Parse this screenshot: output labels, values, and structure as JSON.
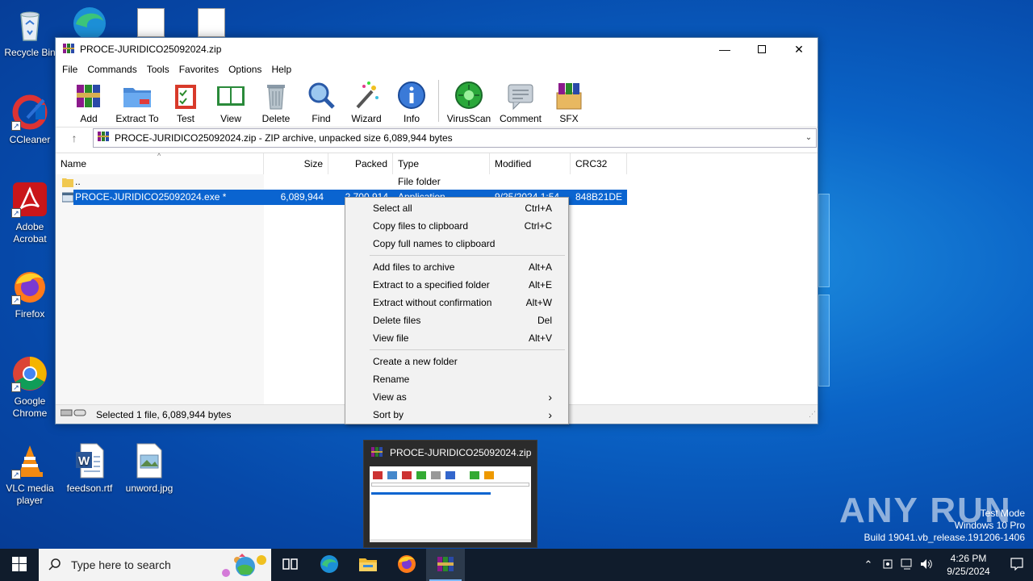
{
  "desktop": {
    "icons": [
      {
        "label": "Recycle Bin",
        "icon": "recycle-bin-icon"
      },
      {
        "label": "CCleaner",
        "icon": "ccleaner-icon"
      },
      {
        "label": "Adobe Acrobat",
        "icon": "adobe-acrobat-icon"
      },
      {
        "label": "Firefox",
        "icon": "firefox-icon"
      },
      {
        "label": "Google Chrome",
        "icon": "chrome-icon"
      },
      {
        "label": "VLC media player",
        "icon": "vlc-icon"
      },
      {
        "label": "feedson.rtf",
        "icon": "word-document-icon"
      },
      {
        "label": "unword.jpg",
        "icon": "image-file-icon"
      }
    ],
    "watermark": {
      "line1": "Test Mode",
      "line2": "Windows 10 Pro",
      "line3": "Build 19041.vb_release.191206-1406"
    },
    "brand": "ANY RUN"
  },
  "window": {
    "title": "PROCE-JURIDICO25092024.zip",
    "menu": [
      "File",
      "Commands",
      "Tools",
      "Favorites",
      "Options",
      "Help"
    ],
    "toolbar": [
      {
        "label": "Add",
        "icon": "add-archive-icon"
      },
      {
        "label": "Extract To",
        "icon": "extract-folder-icon"
      },
      {
        "label": "Test",
        "icon": "test-clipboard-icon"
      },
      {
        "label": "View",
        "icon": "view-book-icon"
      },
      {
        "label": "Delete",
        "icon": "trash-can-icon"
      },
      {
        "label": "Find",
        "icon": "magnifier-icon"
      },
      {
        "label": "Wizard",
        "icon": "magic-wand-icon"
      },
      {
        "label": "Info",
        "icon": "info-icon"
      },
      {
        "label": "VirusScan",
        "icon": "virus-scan-icon"
      },
      {
        "label": "Comment",
        "icon": "comment-icon"
      },
      {
        "label": "SFX",
        "icon": "sfx-box-icon"
      }
    ],
    "address": "PROCE-JURIDICO25092024.zip - ZIP archive, unpacked size 6,089,944 bytes",
    "columns": [
      "Name",
      "Size",
      "Packed",
      "Type",
      "Modified",
      "CRC32"
    ],
    "rows": [
      {
        "name": "..",
        "size": "",
        "packed": "",
        "type": "File folder",
        "modified": "",
        "crc": ""
      },
      {
        "name": "PROCE-JURIDICO25092024.exe *",
        "size": "6,089,944",
        "packed": "2,700,914",
        "type": "Application",
        "modified": "9/25/2024 1:54",
        "crc": "848B21DE"
      }
    ],
    "status": "Selected 1 file, 6,089,944 bytes"
  },
  "context_menu": {
    "groups": [
      [
        {
          "label": "Select all",
          "shortcut": "Ctrl+A"
        },
        {
          "label": "Copy files to clipboard",
          "shortcut": "Ctrl+C"
        },
        {
          "label": "Copy full names to clipboard",
          "shortcut": ""
        }
      ],
      [
        {
          "label": "Add files to archive",
          "shortcut": "Alt+A"
        },
        {
          "label": "Extract to a specified folder",
          "shortcut": "Alt+E"
        },
        {
          "label": "Extract without confirmation",
          "shortcut": "Alt+W"
        },
        {
          "label": "Delete files",
          "shortcut": "Del"
        },
        {
          "label": "View file",
          "shortcut": "Alt+V"
        }
      ],
      [
        {
          "label": "Create a new folder",
          "shortcut": ""
        },
        {
          "label": "Rename",
          "shortcut": ""
        },
        {
          "label": "View as",
          "shortcut": "›"
        },
        {
          "label": "Sort by",
          "shortcut": "›"
        }
      ]
    ]
  },
  "thumbnail": {
    "title": "PROCE-JURIDICO25092024.zip"
  },
  "taskbar": {
    "search_placeholder": "Type here to search",
    "apps": [
      "task-view-icon",
      "edge-icon",
      "file-explorer-icon",
      "firefox-icon",
      "winrar-icon"
    ],
    "time": "4:26 PM",
    "date": "9/25/2024"
  },
  "colors": {
    "selection": "#0a64d0",
    "desktop": "#0a63c6",
    "taskbar": "#101c2c"
  }
}
